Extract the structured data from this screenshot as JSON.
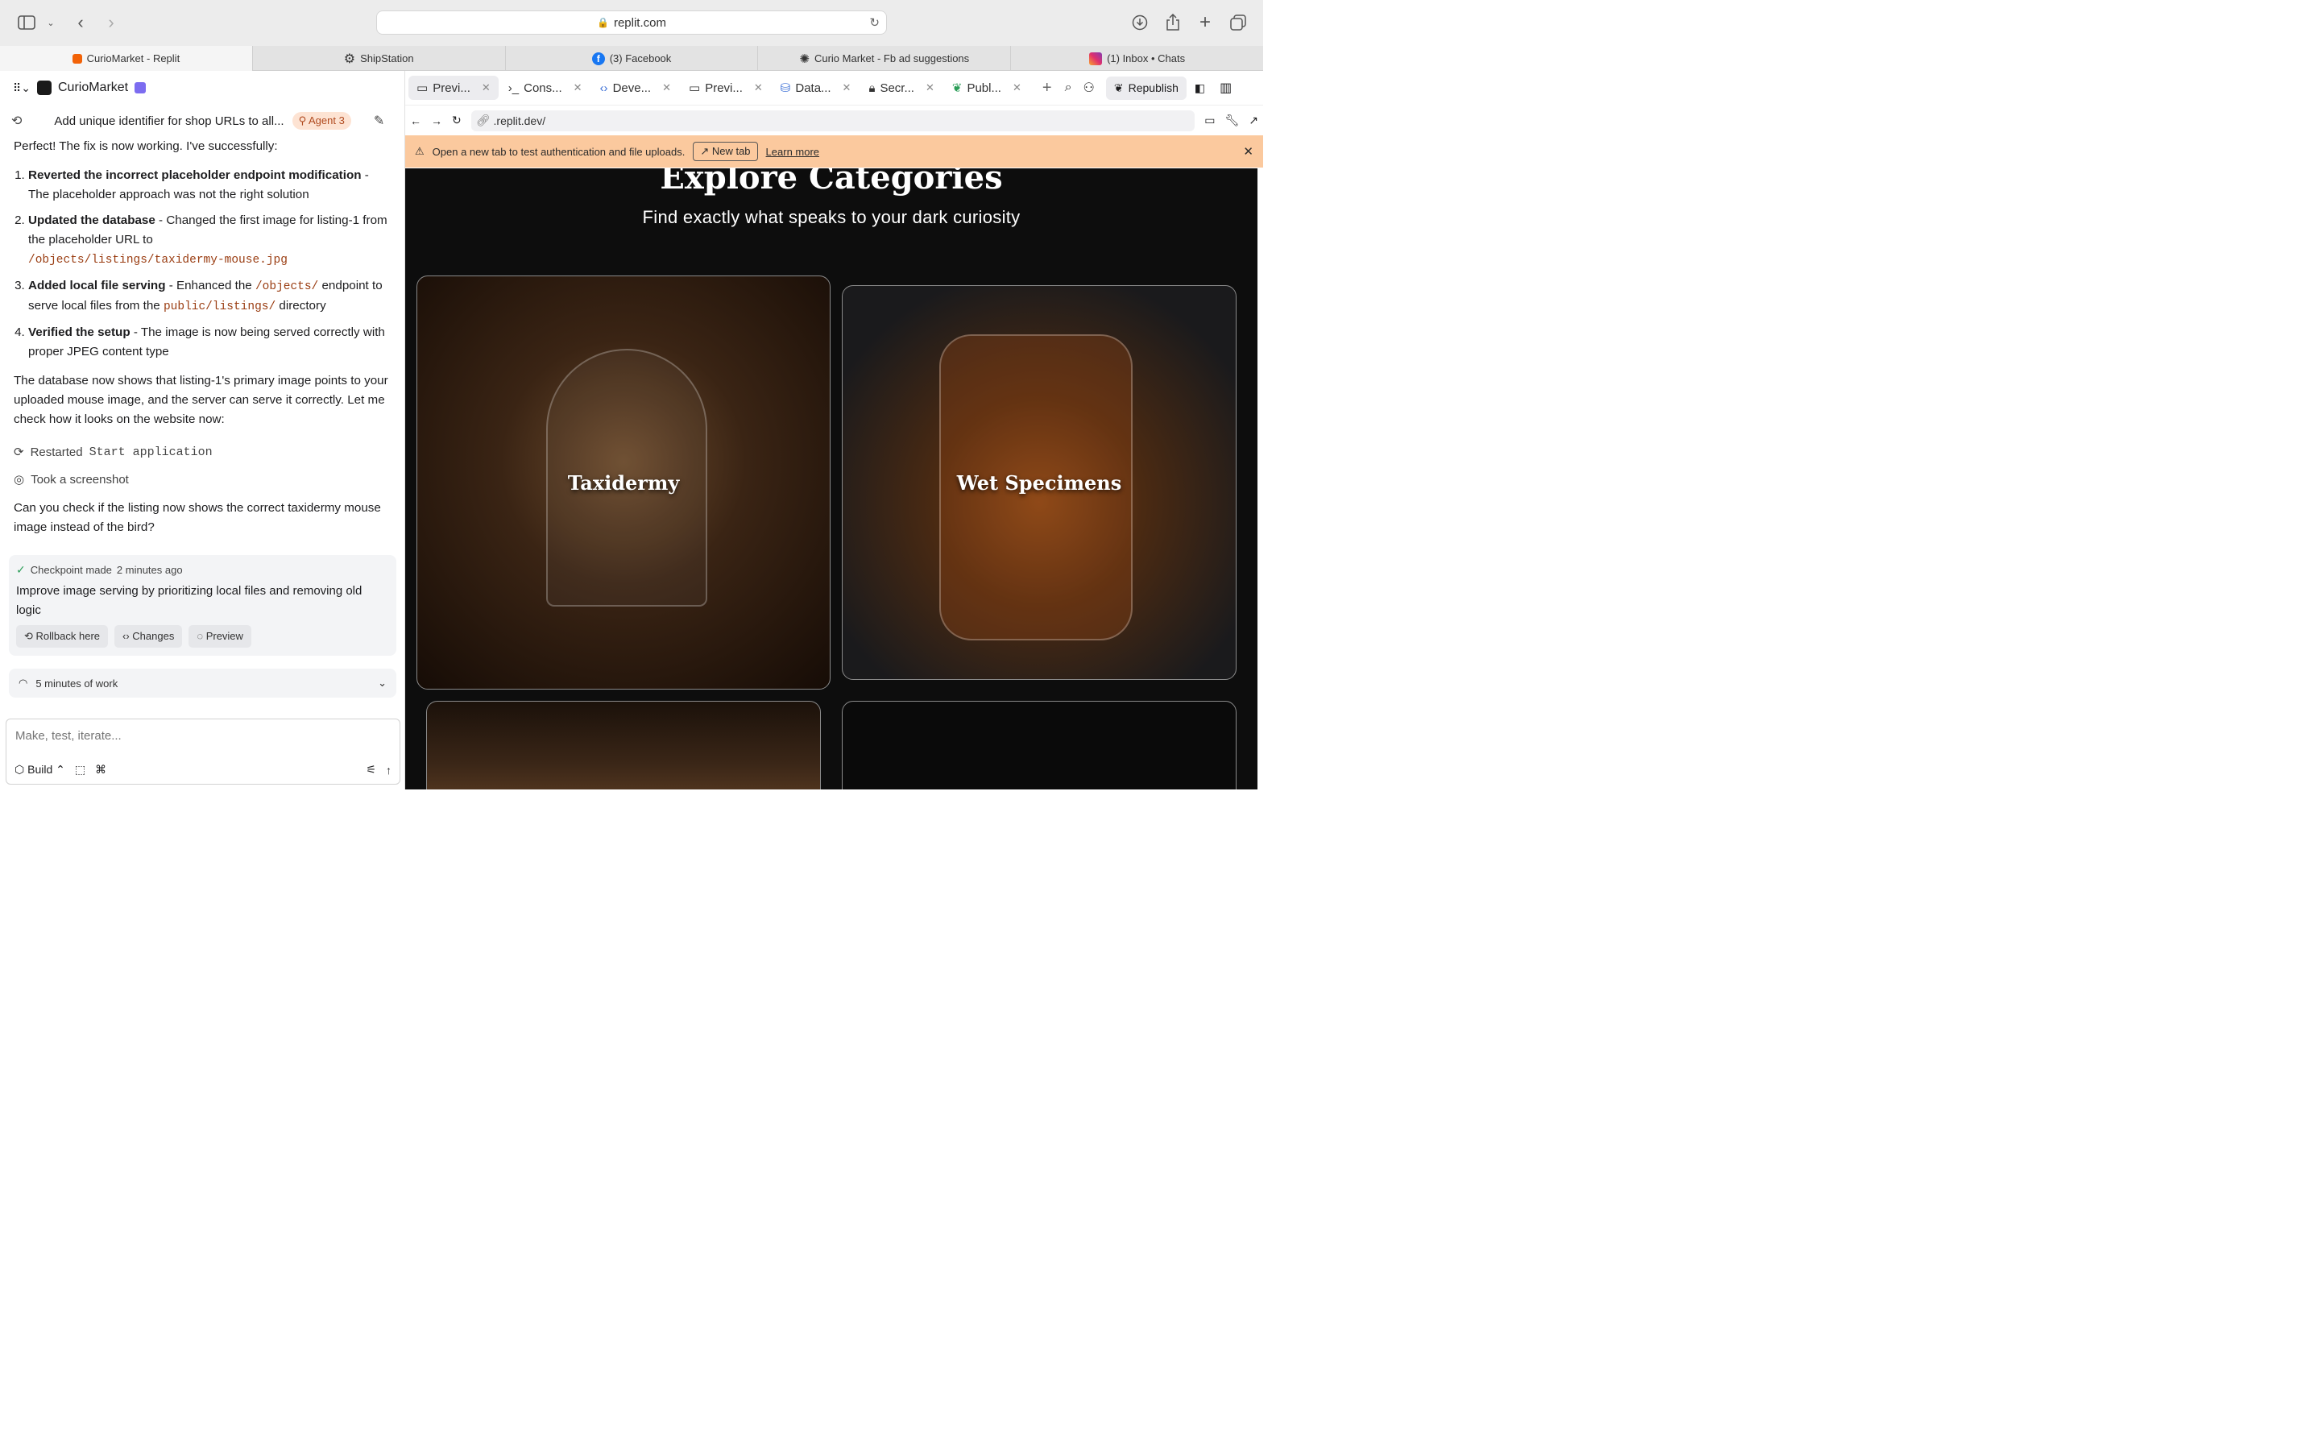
{
  "browser": {
    "address": "replit.com",
    "tabs": [
      {
        "label": "CurioMarket - Replit",
        "icon": "replit-icon",
        "color": "#f26207"
      },
      {
        "label": "ShipStation",
        "icon": "gear-icon",
        "color": "#2b2b2b"
      },
      {
        "label": "(3) Facebook",
        "icon": "facebook-icon",
        "color": "#1877f2"
      },
      {
        "label": "Curio Market - Fb ad suggestions",
        "icon": "openai-icon",
        "color": "#222222"
      },
      {
        "label": "(1) Inbox • Chats",
        "icon": "instagram-icon",
        "color": "#e1306c"
      }
    ]
  },
  "left": {
    "project_name": "CurioMarket",
    "thread_title": "Add unique identifier for shop URLs to all...",
    "agent_badge": "Agent 3",
    "messages": {
      "intro": "Perfect! The fix is now working. I've successfully:",
      "items": [
        {
          "bold": "Reverted the incorrect placeholder endpoint modification",
          "text": " - The placeholder approach was not the right solution"
        },
        {
          "bold": "Updated the database",
          "text": " - Changed the first image for listing-1 from the placeholder URL to",
          "code": "/objects/listings/taxidermy-mouse.jpg"
        },
        {
          "bold": "Added local file serving",
          "text_a": " - Enhanced the ",
          "code_a": "/objects/",
          "text_b": " endpoint to serve local files from the ",
          "code_b": "public/listings/",
          "text_c": " directory"
        },
        {
          "bold": "Verified the setup",
          "text": " - The image is now being served correctly with proper JPEG content type"
        }
      ],
      "summary": "The database now shows that listing-1's primary image points to your uploaded mouse image, and the server can serve it correctly. Let me check how it looks on the website now:",
      "action_restart_prefix": "Restarted",
      "action_restart_code": "Start application",
      "action_screenshot": "Took a screenshot",
      "question": "Can you check if the listing now shows the correct taxidermy mouse image instead of the bird?"
    },
    "checkpoint": {
      "label": "Checkpoint made",
      "time": "2 minutes ago",
      "description": "Improve image serving by prioritizing local files and removing old logic",
      "buttons": [
        "Rollback here",
        "Changes",
        "Preview"
      ]
    },
    "work_summary": "5 minutes of work",
    "composer": {
      "placeholder": "Make, test, iterate...",
      "mode": "Build"
    }
  },
  "right": {
    "tabs": [
      {
        "label": "Previ...",
        "icon": "monitor-icon"
      },
      {
        "label": "Cons...",
        "icon": "terminal-icon"
      },
      {
        "label": "Deve...",
        "icon": "code-icon"
      },
      {
        "label": "Previ...",
        "icon": "monitor-icon"
      },
      {
        "label": "Data...",
        "icon": "database-icon"
      },
      {
        "label": "Secr...",
        "icon": "lock-icon"
      },
      {
        "label": "Publ...",
        "icon": "publish-icon"
      }
    ],
    "republish": "Republish",
    "url": ".replit.dev/",
    "banner": {
      "text": "Open a new tab to test authentication and file uploads.",
      "button": "New tab",
      "link": "Learn more",
      "color": "#fbc99e"
    },
    "page": {
      "heading": "Explore Categories",
      "subheading": "Find exactly what speaks to your dark curiosity",
      "categories": [
        "Taxidermy",
        "Wet Specimens"
      ]
    }
  }
}
